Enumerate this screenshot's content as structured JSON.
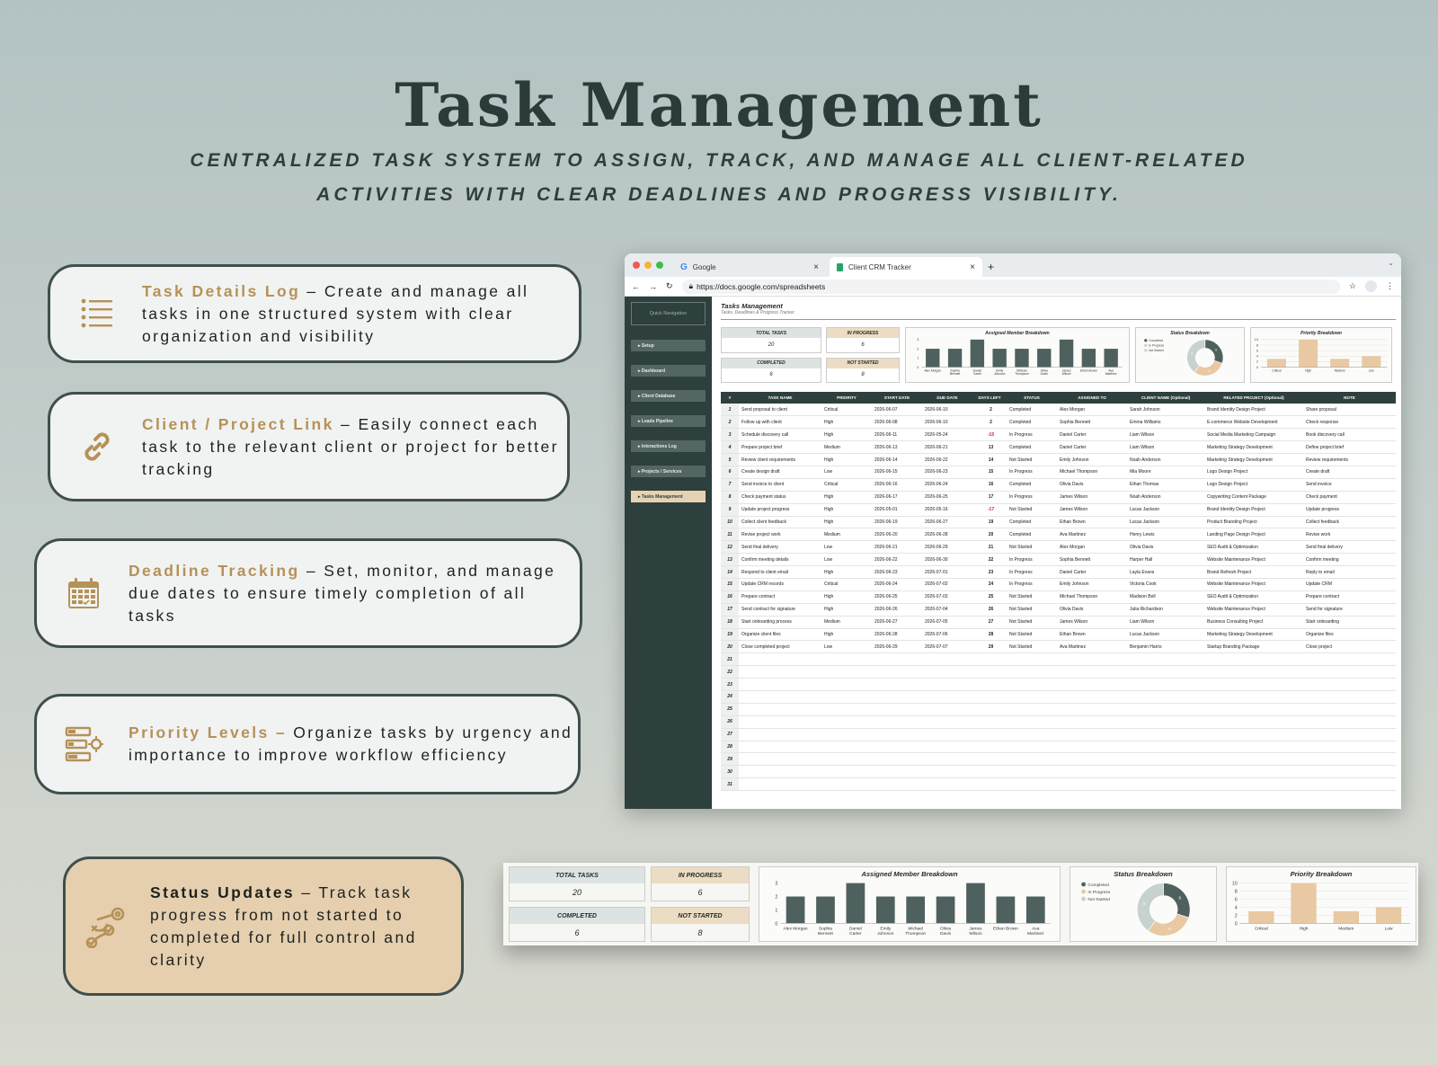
{
  "title": "Task Management",
  "subtitle_line1": "CENTRALIZED TASK SYSTEM TO ASSIGN, TRACK, AND MANAGE ALL CLIENT-RELATED",
  "subtitle_line2": "ACTIVITIES WITH CLEAR DEADLINES AND PROGRESS VISIBILITY.",
  "colors": {
    "accent_gold": "#b69158",
    "dark_green": "#2e403d",
    "tan": "#e6cfae",
    "bar_green": "#4f615e",
    "bar_tan": "#e8c9a3"
  },
  "features": [
    {
      "icon": "list-icon",
      "title": "Task Details Log",
      "sep": " – ",
      "desc": "Create and manage all tasks in one structured system with clear organization and visibility"
    },
    {
      "icon": "link-icon",
      "title": "Client / Project Link",
      "sep": " – ",
      "desc": "Easily connect each task to the relevant client or project for better tracking"
    },
    {
      "icon": "calendar-icon",
      "title": "Deadline Tracking",
      "sep": " – ",
      "desc": "Set, monitor, and manage due dates to ensure timely completion of all tasks"
    },
    {
      "icon": "priority-icon",
      "title": "Priority Levels –",
      "sep": " ",
      "desc": "Organize tasks by urgency and importance to improve workflow efficiency"
    },
    {
      "icon": "progress-target-icon",
      "title": "Status Updates",
      "sep": " – ",
      "desc": "Track task progress from not started to completed for full control and clarity"
    }
  ],
  "browser": {
    "tab1": "Google",
    "tab2": "Client CRM Tracker",
    "url": "https://docs.google.com/spreadsheets"
  },
  "sheet": {
    "quick_nav": "Quick Navigation",
    "nav": [
      "Setup",
      "Dashboard",
      "Client Database",
      "Leads Pipeline",
      "Interactions Log",
      "Projects / Services",
      "Tasks Management"
    ],
    "title": "Tasks Management",
    "subtitle": "Tasks, Deadlines & Progress Tracker",
    "kpis": [
      {
        "label": "TOTAL TASKS",
        "value": "20"
      },
      {
        "label": "IN PROGRESS",
        "value": "6"
      },
      {
        "label": "COMPLETED",
        "value": "6"
      },
      {
        "label": "NOT STARTED",
        "value": "8"
      }
    ],
    "columns": [
      "#",
      "TASK NAME",
      "PRIORITY",
      "START DATE",
      "DUE DATE",
      "DAYS LEFT",
      "STATUS",
      "ASSIGNED TO",
      "CLIENT NAME (Optional)",
      "RELATED PROJECT (Optional)",
      "NOTE"
    ],
    "rows": [
      [
        "1",
        "Send proposal to client",
        "Critical",
        "2026-06-07",
        "2026-06-10",
        "2",
        "Completed",
        "Alex Morgan",
        "Sarah Johnson",
        "Brand Identity Design Project",
        "Share proposal"
      ],
      [
        "2",
        "Follow up with client",
        "High",
        "2026-06-08",
        "2026-06-10",
        "2",
        "Completed",
        "Sophia Bennett",
        "Emma Williams",
        "E-commerce Website Development",
        "Check response"
      ],
      [
        "3",
        "Schedule discovery call",
        "High",
        "2026-06-11",
        "2026-05-24",
        "-15",
        "In Progress",
        "Daniel Carter",
        "Liam Wilson",
        "Social Media Marketing Campaign",
        "Book discovery call"
      ],
      [
        "4",
        "Prepare project brief",
        "Medium",
        "2026-06-13",
        "2026-06-21",
        "13",
        "Completed",
        "Daniel Carter",
        "Liam Wilson",
        "Marketing Strategy Development",
        "Define project brief"
      ],
      [
        "5",
        "Review client requirements",
        "High",
        "2026-06-14",
        "2026-06-22",
        "14",
        "Not Started",
        "Emily Johnson",
        "Noah Anderson",
        "Marketing Strategy Development",
        "Review requirements"
      ],
      [
        "6",
        "Create design draft",
        "Low",
        "2026-06-15",
        "2026-06-23",
        "15",
        "In Progress",
        "Michael Thompson",
        "Mia Moore",
        "Logo Design Project",
        "Create draft"
      ],
      [
        "7",
        "Send invoice to client",
        "Critical",
        "2026-06-16",
        "2026-06-24",
        "16",
        "Completed",
        "Olivia Davis",
        "Ethan Thomas",
        "Logo Design Project",
        "Send invoice"
      ],
      [
        "8",
        "Check payment status",
        "High",
        "2026-06-17",
        "2026-06-25",
        "17",
        "In Progress",
        "James Wilson",
        "Noah Anderson",
        "Copywriting Content Package",
        "Check payment"
      ],
      [
        "9",
        "Update project progress",
        "High",
        "2026-05-01",
        "2026-05-16",
        "-17",
        "Not Started",
        "James Wilson",
        "Lucas Jackson",
        "Brand Identity Design Project",
        "Update progress"
      ],
      [
        "10",
        "Collect client feedback",
        "High",
        "2026-06-19",
        "2026-06-27",
        "19",
        "Completed",
        "Ethan Brown",
        "Lucas Jackson",
        "Product Branding Project",
        "Collect feedback"
      ],
      [
        "11",
        "Revise project work",
        "Medium",
        "2026-06-20",
        "2026-06-28",
        "20",
        "Completed",
        "Ava Martinez",
        "Henry Lewis",
        "Landing Page Design Project",
        "Revise work"
      ],
      [
        "12",
        "Send final delivery",
        "Low",
        "2026-06-21",
        "2026-06-29",
        "21",
        "Not Started",
        "Alex Morgan",
        "Olivia Davis",
        "SEO Audit & Optimization",
        "Send final delivery"
      ],
      [
        "13",
        "Confirm meeting details",
        "Low",
        "2026-06-22",
        "2026-06-30",
        "22",
        "In Progress",
        "Sophia Bennett",
        "Harper Hall",
        "Website Maintenance Project",
        "Confirm meeting"
      ],
      [
        "14",
        "Respond to client email",
        "High",
        "2026-06-23",
        "2026-07-01",
        "23",
        "In Progress",
        "Daniel Carter",
        "Layla Evans",
        "Brand Refresh Project",
        "Reply to email"
      ],
      [
        "15",
        "Update CRM records",
        "Critical",
        "2026-06-24",
        "2026-07-02",
        "24",
        "In Progress",
        "Emily Johnson",
        "Victoria Cook",
        "Website Maintenance Project",
        "Update CRM"
      ],
      [
        "16",
        "Prepare contract",
        "High",
        "2026-06-25",
        "2026-07-03",
        "25",
        "Not Started",
        "Michael Thompson",
        "Madison Bell",
        "SEO Audit & Optimization",
        "Prepare contract"
      ],
      [
        "17",
        "Send contract for signature",
        "High",
        "2026-06-26",
        "2026-07-04",
        "26",
        "Not Started",
        "Olivia Davis",
        "Julia Richardson",
        "Website Maintenance Project",
        "Send for signature"
      ],
      [
        "18",
        "Start onboarding process",
        "Medium",
        "2026-06-27",
        "2026-07-05",
        "27",
        "Not Started",
        "James Wilson",
        "Liam Wilson",
        "Business Consulting Project",
        "Start onboarding"
      ],
      [
        "19",
        "Organize client files",
        "High",
        "2026-06-28",
        "2026-07-06",
        "28",
        "Not Started",
        "Ethan Brown",
        "Lucas Jackson",
        "Marketing Strategy Development",
        "Organize files"
      ],
      [
        "20",
        "Close completed project",
        "Low",
        "2026-06-29",
        "2026-07-07",
        "29",
        "Not Started",
        "Ava Martinez",
        "Benjamin Harris",
        "Startup Branding Package",
        "Close project"
      ]
    ],
    "empty_rows": [
      "21",
      "22",
      "23",
      "24",
      "25",
      "26",
      "27",
      "28",
      "29",
      "30",
      "31"
    ]
  },
  "chart_data": [
    {
      "type": "bar",
      "title": "Assigned Member Breakdown",
      "categories": [
        "Alex Morgan",
        "Sophia Bennett",
        "Daniel Carter",
        "Emily Johnson",
        "Michael Thompson",
        "Olivia Davis",
        "James Wilson",
        "Ethan Brown",
        "Ava Martinez"
      ],
      "values": [
        2,
        2,
        3,
        2,
        2,
        2,
        3,
        2,
        2
      ],
      "ylim": [
        0,
        3
      ],
      "grid": false
    },
    {
      "type": "pie",
      "title": "Status Breakdown",
      "categories": [
        "Completed",
        "In Progress",
        "Not Started"
      ],
      "values": [
        6,
        6,
        8
      ],
      "colors": [
        "#4f615e",
        "#e8c9a3",
        "#c7d1d0"
      ],
      "legend": "left"
    },
    {
      "type": "bar",
      "title": "Priority Breakdown",
      "categories": [
        "Critical",
        "High",
        "Medium",
        "Low"
      ],
      "values": [
        3,
        10,
        3,
        4
      ],
      "ylim": [
        0,
        10
      ],
      "grid": true
    }
  ]
}
